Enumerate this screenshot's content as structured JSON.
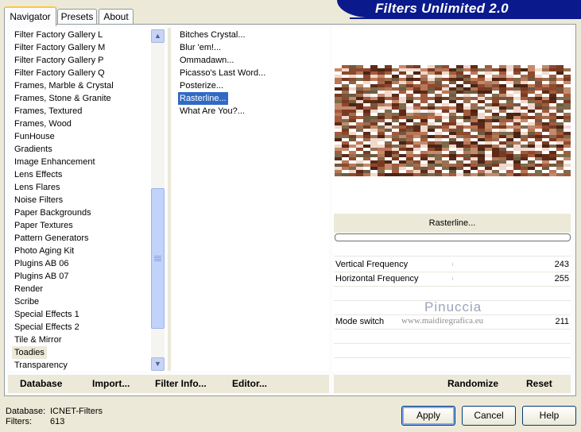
{
  "app_title": "Filters Unlimited 2.0",
  "tabs": [
    "Navigator",
    "Presets",
    "About"
  ],
  "categories": [
    "Filter Factory Gallery L",
    "Filter Factory Gallery M",
    "Filter Factory Gallery P",
    "Filter Factory Gallery Q",
    "Frames, Marble & Crystal",
    "Frames, Stone & Granite",
    "Frames, Textured",
    "Frames, Wood",
    "FunHouse",
    "Gradients",
    "Image Enhancement",
    "Lens Effects",
    "Lens Flares",
    "Noise Filters",
    "Paper Backgrounds",
    "Paper Textures",
    "Pattern Generators",
    "Photo Aging Kit",
    "Plugins AB 06",
    "Plugins AB 07",
    "Render",
    "Scribe",
    "Special Effects 1",
    "Special Effects 2",
    "Tile & Mirror",
    "Toadies",
    "Transparency"
  ],
  "selected_category": "Toadies",
  "filters": [
    "Bitches Crystal...",
    "Blur 'em!...",
    "Ommadawn...",
    "Picasso's Last Word...",
    "Posterize...",
    "Rasterline...",
    "What Are You?..."
  ],
  "selected_filter": "Rasterline...",
  "filter_name": "Rasterline...",
  "params": [
    {
      "label": "Vertical Frequency",
      "value": "243"
    },
    {
      "label": "Horizontal Frequency",
      "value": "255"
    },
    {
      "label": "Mode switch",
      "value": "211"
    }
  ],
  "watermark": {
    "name": "Pinuccia",
    "url": "www.maidiregrafica.eu"
  },
  "toolbar": {
    "database": "Database",
    "import": "Import...",
    "filter_info": "Filter Info...",
    "editor": "Editor...",
    "randomize": "Randomize",
    "reset": "Reset"
  },
  "status": {
    "database_label": "Database:",
    "database_value": "ICNET-Filters",
    "filters_label": "Filters:",
    "filters_value": "613"
  },
  "buttons": {
    "apply": "Apply",
    "cancel": "Cancel",
    "help": "Help"
  },
  "colors": {
    "banner": "#0a1a8c",
    "selection": "#316ac5",
    "tab_highlight": "#ffc83c"
  }
}
